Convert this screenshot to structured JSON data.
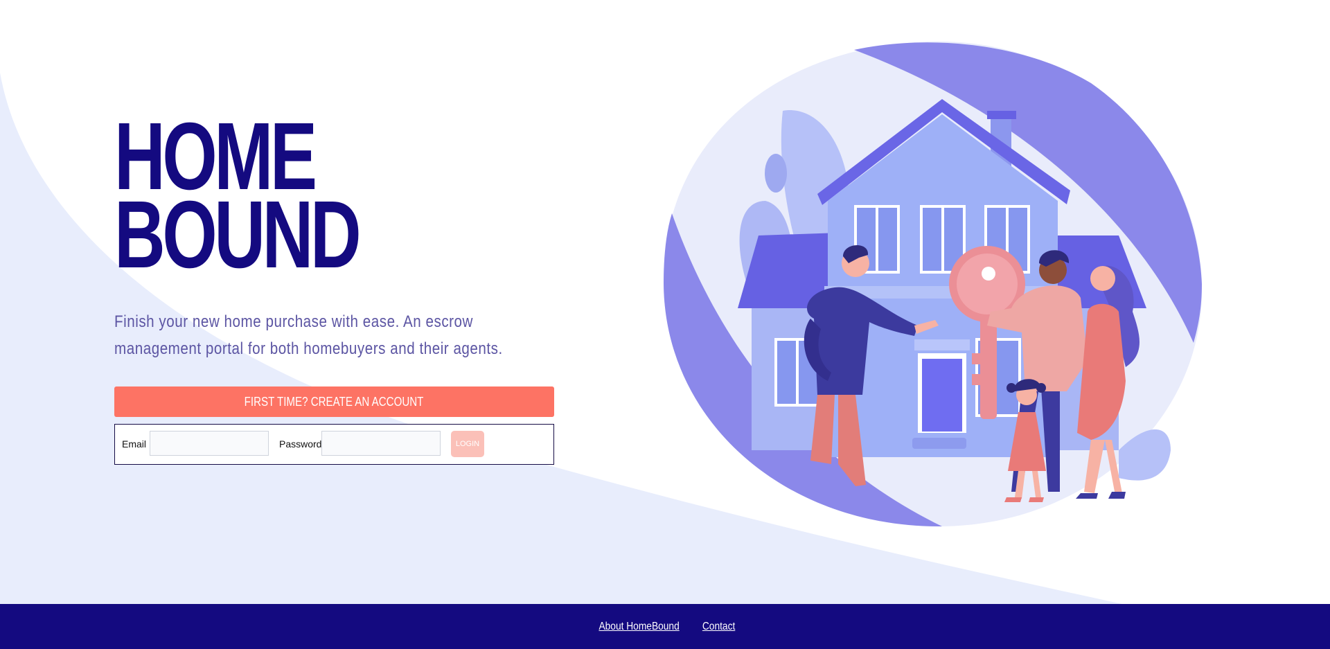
{
  "brand": {
    "title_line1": "HOME",
    "title_line2": "BOUND"
  },
  "tagline": "Finish your new home purchase with ease. An escrow management portal for both homebuyers and their agents.",
  "cta": {
    "label": "FIRST TIME? CREATE AN ACCOUNT"
  },
  "login": {
    "email_label": "Email",
    "email_value": "",
    "password_label": "Password",
    "password_value": "",
    "button_label": "LOGIN"
  },
  "footer": {
    "links": [
      "About HomeBound",
      "Contact"
    ]
  },
  "colors": {
    "brand_navy": "#140a80",
    "accent_coral": "#fd7364",
    "swoosh_bg": "#e8edfc",
    "illustration_purple": "#8b88ea"
  }
}
